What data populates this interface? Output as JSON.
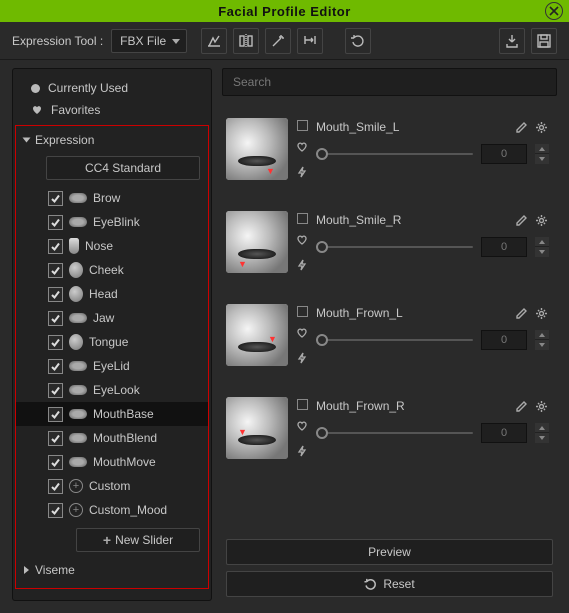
{
  "title": "Facial Profile Editor",
  "toolbar": {
    "label": "Expression Tool :",
    "select": "FBX File"
  },
  "left": {
    "currently_used": "Currently Used",
    "favorites": "Favorites",
    "expression": "Expression",
    "standard": "CC4 Standard",
    "items": [
      {
        "label": "Brow",
        "checked": true,
        "type": "lips"
      },
      {
        "label": "EyeBlink",
        "checked": true,
        "type": "lips"
      },
      {
        "label": "Nose",
        "checked": true,
        "type": "nose"
      },
      {
        "label": "Cheek",
        "checked": true,
        "type": "face"
      },
      {
        "label": "Head",
        "checked": true,
        "type": "face"
      },
      {
        "label": "Jaw",
        "checked": true,
        "type": "lips"
      },
      {
        "label": "Tongue",
        "checked": true,
        "type": "face"
      },
      {
        "label": "EyeLid",
        "checked": true,
        "type": "lips"
      },
      {
        "label": "EyeLook",
        "checked": true,
        "type": "lips"
      },
      {
        "label": "MouthBase",
        "checked": true,
        "type": "lips",
        "selected": true
      },
      {
        "label": "MouthBlend",
        "checked": true,
        "type": "lips"
      },
      {
        "label": "MouthMove",
        "checked": true,
        "type": "lips"
      },
      {
        "label": "Custom",
        "checked": true,
        "type": "plus"
      },
      {
        "label": "Custom_Mood",
        "checked": true,
        "type": "plus"
      }
    ],
    "new_slider": "New Slider",
    "viseme": "Viseme"
  },
  "search": {
    "placeholder": "Search"
  },
  "sliders": [
    {
      "name": "Mouth_Smile_L",
      "value": 0,
      "marks": [
        {
          "t": "48",
          "l": "40"
        }
      ]
    },
    {
      "name": "Mouth_Smile_R",
      "value": 0,
      "marks": [
        {
          "t": "48",
          "l": "12"
        }
      ]
    },
    {
      "name": "Mouth_Frown_L",
      "value": 0,
      "marks": [
        {
          "t": "30",
          "l": "42"
        }
      ]
    },
    {
      "name": "Mouth_Frown_R",
      "value": 0,
      "marks": [
        {
          "t": "30",
          "l": "12"
        }
      ]
    }
  ],
  "buttons": {
    "preview": "Preview",
    "reset": "Reset"
  }
}
